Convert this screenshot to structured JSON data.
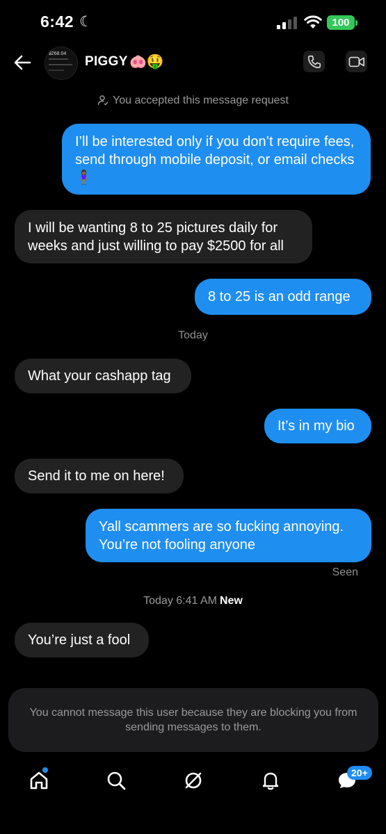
{
  "status_bar": {
    "time": "6:42",
    "battery": "100"
  },
  "header": {
    "username": "PIGGY",
    "emoji": "🐽🤑",
    "avatar_amount": "$268.04"
  },
  "request_notice": "You accepted this message request",
  "messages": [
    {
      "side": "sent",
      "text": "I’ll be interested only if you don’t require fees, send through mobile deposit, or email checks 🧍🏾‍♀️"
    },
    {
      "side": "received",
      "text": "I will be wanting 8 to 25 pictures daily for weeks and just willing to pay $2500 for all"
    },
    {
      "side": "sent",
      "text": "8 to 25 is an odd range"
    },
    {
      "side": "received",
      "text": "What your cashapp tag"
    },
    {
      "side": "sent",
      "text": "It’s in my bio"
    },
    {
      "side": "received",
      "text": "Send it to me on here!"
    },
    {
      "side": "sent",
      "text": "Yall scammers are so fucking annoying. You’re not fooling anyone"
    },
    {
      "side": "received",
      "text": "You’re just a fool"
    }
  ],
  "separators": {
    "today": "Today",
    "seen": "Seen",
    "timestamp": "Today 6:41 AM",
    "new": "New"
  },
  "blocked_notice": "You cannot message this user because they are blocking you from sending messages to them.",
  "bottom_nav": {
    "items": [
      "home-icon",
      "search-icon",
      "explore-icon",
      "notifications-icon",
      "messages-icon"
    ],
    "messages_badge": "20+"
  },
  "colors": {
    "sent_bubble": "#1f8ef1",
    "received_bubble": "#222222",
    "battery": "#35c759"
  }
}
